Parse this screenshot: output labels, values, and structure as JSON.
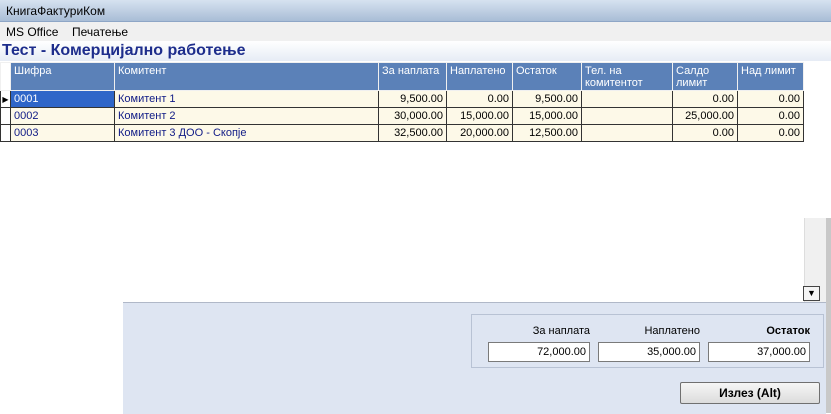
{
  "window": {
    "title": "КнигаФактуриКом"
  },
  "menu": {
    "items": [
      "MS Office",
      "Печатење"
    ]
  },
  "form": {
    "title": "Тест - Комерцијално работење"
  },
  "grid": {
    "columns": [
      "Шифра",
      "Комитент",
      "За наплата",
      "Наплатено",
      "Остаток",
      "Тел. на комитентот",
      "Салдо лимит",
      "Над лимит"
    ],
    "rows": [
      {
        "sifra": "0001",
        "komitent": "Комитент 1",
        "za_naplata": "9,500.00",
        "naplateno": "0.00",
        "ostatok": "9,500.00",
        "tel": "",
        "saldo_limit": "0.00",
        "nad_limit": "0.00"
      },
      {
        "sifra": "0002",
        "komitent": "Комитент 2",
        "za_naplata": "30,000.00",
        "naplateno": "15,000.00",
        "ostatok": "15,000.00",
        "tel": "",
        "saldo_limit": "25,000.00",
        "nad_limit": "0.00"
      },
      {
        "sifra": "0003",
        "komitent": "Комитент 3 ДОО - Скопје",
        "za_naplata": "32,500.00",
        "naplateno": "20,000.00",
        "ostatok": "12,500.00",
        "tel": "",
        "saldo_limit": "0.00",
        "nad_limit": "0.00"
      }
    ],
    "current_row_marker": "▶",
    "selected_row": 0
  },
  "totals": {
    "za_naplata_label": "За наплата",
    "za_naplata_value": "72,000.00",
    "naplateno_label": "Наплатено",
    "naplateno_value": "35,000.00",
    "ostatok_label": "Остаток",
    "ostatok_value": "37,000.00"
  },
  "buttons": {
    "exit_label": "Излез (Alt)"
  },
  "colors": {
    "grid_header": "#5b81b8",
    "row_bg": "#fdf9e8",
    "selection": "#2f66c8",
    "title_text": "#1d2d8c",
    "panel_bg": "#dee5f2"
  },
  "icons": {
    "dropdown": "chevron-down-icon",
    "row_pointer": "row-pointer-icon"
  }
}
